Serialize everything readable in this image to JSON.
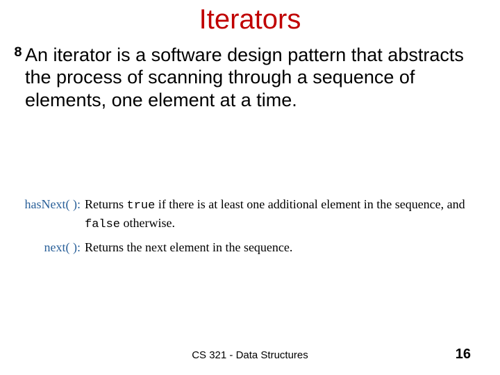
{
  "title": "Iterators",
  "bullet": {
    "marker": "8",
    "text": "An iterator is a software design pattern that abstracts the process of scanning through a sequence of elements, one element at a time."
  },
  "methods": [
    {
      "name": "hasNext( ):",
      "desc_pre": "Returns ",
      "kw1": "true",
      "desc_mid": " if there is at least one additional element in the sequence, and ",
      "kw2": "false",
      "desc_post": " otherwise."
    },
    {
      "name": "next( ):",
      "desc_pre": "Returns the next element in the sequence.",
      "kw1": "",
      "desc_mid": "",
      "kw2": "",
      "desc_post": ""
    }
  ],
  "footer": {
    "course": "CS 321 - Data Structures",
    "page": "16"
  }
}
